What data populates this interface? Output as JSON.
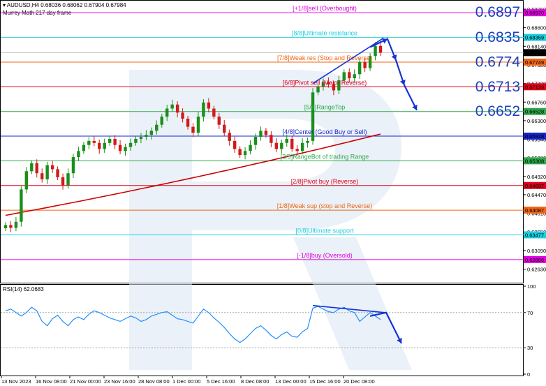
{
  "header": {
    "symbol_line": "AUDUSD,H4   0.68036  0.68062  0.67904  0.67984",
    "indicator_line": "Murrey Math 217 day frame"
  },
  "rsi_header": "RSI(14) 62.0683",
  "colors": {
    "bull": "#1a8f1a",
    "bear": "#d11a1a",
    "ma": "#cc0000",
    "rsi": "#1e90ff",
    "arrow": "#1533d6",
    "watermark": "#dbe6f3"
  },
  "chart_data": [
    {
      "type": "candlestick",
      "title": "AUDUSD,H4",
      "ylim": [
        0.6238,
        0.6925
      ],
      "y_ticks": [
        "0.69060",
        "0.68600",
        "0.68140",
        "0.67680",
        "0.67220",
        "0.66760",
        "0.66300",
        "0.65840",
        "0.65380",
        "0.64920",
        "0.64470",
        "0.64010",
        "0.63550",
        "0.63090",
        "0.62630"
      ],
      "x_labels": [
        "13 Nov 2023",
        "16 Nov 08:00",
        "21 Nov 00:00",
        "23 Nov 16:00",
        "28 Nov 08:00",
        "1 Dec 00:00",
        "5 Dec 16:00",
        "8 Dec 08:00",
        "13 Dec 00:00",
        "15 Dec 16:00",
        "20 Dec 08:00"
      ],
      "close_series": [
        0.6372,
        0.6365,
        0.638,
        0.646,
        0.6505,
        0.6525,
        0.65,
        0.6485,
        0.652,
        0.651,
        0.649,
        0.647,
        0.65,
        0.654,
        0.6555,
        0.657,
        0.658,
        0.6575,
        0.656,
        0.6575,
        0.6585,
        0.657,
        0.6555,
        0.6565,
        0.6575,
        0.6585,
        0.659,
        0.6595,
        0.6605,
        0.662,
        0.664,
        0.666,
        0.667,
        0.665,
        0.6635,
        0.6615,
        0.66,
        0.664,
        0.6675,
        0.666,
        0.664,
        0.662,
        0.66,
        0.658,
        0.656,
        0.6545,
        0.6555,
        0.657,
        0.659,
        0.6605,
        0.6595,
        0.6575,
        0.656,
        0.6575,
        0.6585,
        0.656,
        0.6555,
        0.6575,
        0.658,
        0.67,
        0.6715,
        0.6725,
        0.672,
        0.6705,
        0.673,
        0.675,
        0.6735,
        0.6745,
        0.6775,
        0.676,
        0.679,
        0.6815,
        0.6798
      ],
      "moving_average": {
        "start": 0.6396,
        "end": 0.6597
      },
      "murrey_levels": [
        {
          "label": "[+1/8]sell (Overbought)",
          "price": 0.6897,
          "tag": "0.68970",
          "color": "#e000e0",
          "text_color": "#e000e0"
        },
        {
          "label": "[8/8]Ultimate resistance",
          "price": 0.68359,
          "tag": "0.68359",
          "color": "#19d0e0",
          "text_color": "#19d0e0"
        },
        {
          "label": "[7/8]Weak res (Stop and Reverse)",
          "price": 0.67749,
          "tag": "0.67749",
          "color": "#f06414",
          "text_color": "#f06414"
        },
        {
          "label": "[6/8]Pivot sell (Major Reverse)",
          "price": 0.67139,
          "tag": "0.67139",
          "color": "#e0001a",
          "text_color": "#e0001a"
        },
        {
          "label": "[5/8]RangeTop",
          "price": 0.66528,
          "tag": "0.66528",
          "color": "#2ea84a",
          "text_color": "#2ea84a"
        },
        {
          "label": "[4/8]Center (Good Buy or Sell)",
          "price": 0.65918,
          "tag": "0.65918",
          "color": "#1424c8",
          "text_color": "#1424c8"
        },
        {
          "label": "[3/8]RangeBot of trading Range",
          "price": 0.65308,
          "tag": "0.65308",
          "color": "#2ea84a",
          "text_color": "#2ea84a"
        },
        {
          "label": "[2/8]Pivot buy (Reverse)",
          "price": 0.64697,
          "tag": "0.64697",
          "color": "#e0001a",
          "text_color": "#e0001a"
        },
        {
          "label": "[1/8]Weak sup (stop and Reverse)",
          "price": 0.64087,
          "tag": "0.64087",
          "color": "#f06414",
          "text_color": "#f06414"
        },
        {
          "label": "[0/8]Ultimate support",
          "price": 0.63477,
          "tag": "0.63477",
          "color": "#19d0e0",
          "text_color": "#19d0e0"
        },
        {
          "label": "[-1/8]buy (Oversold)",
          "price": 0.62866,
          "tag": "0.62866",
          "color": "#e000e0",
          "text_color": "#e000e0"
        }
      ],
      "current_price_tag": "0.67984",
      "big_targets": [
        "0.6897",
        "0.6835",
        "0.6774",
        "0.6713",
        "0.6652"
      ]
    },
    {
      "type": "line",
      "title": "RSI(14) 62.0683",
      "ylim": [
        0,
        100
      ],
      "y_ticks": [
        "100",
        "70",
        "30",
        "0"
      ],
      "levels": [
        70,
        30
      ],
      "values": [
        72,
        74,
        70,
        66,
        70,
        76,
        72,
        60,
        55,
        63,
        67,
        60,
        55,
        62,
        65,
        62,
        68,
        72,
        70,
        67,
        64,
        62,
        60,
        63,
        66,
        64,
        60,
        62,
        66,
        68,
        70,
        71,
        67,
        63,
        62,
        60,
        58,
        66,
        74,
        70,
        64,
        59,
        53,
        46,
        40,
        36,
        40,
        46,
        52,
        55,
        50,
        44,
        40,
        45,
        48,
        43,
        42,
        48,
        52,
        75,
        77,
        74,
        71,
        70,
        74,
        76,
        72,
        70,
        60,
        65,
        70,
        66,
        62
      ],
      "current": 62.0683
    }
  ]
}
